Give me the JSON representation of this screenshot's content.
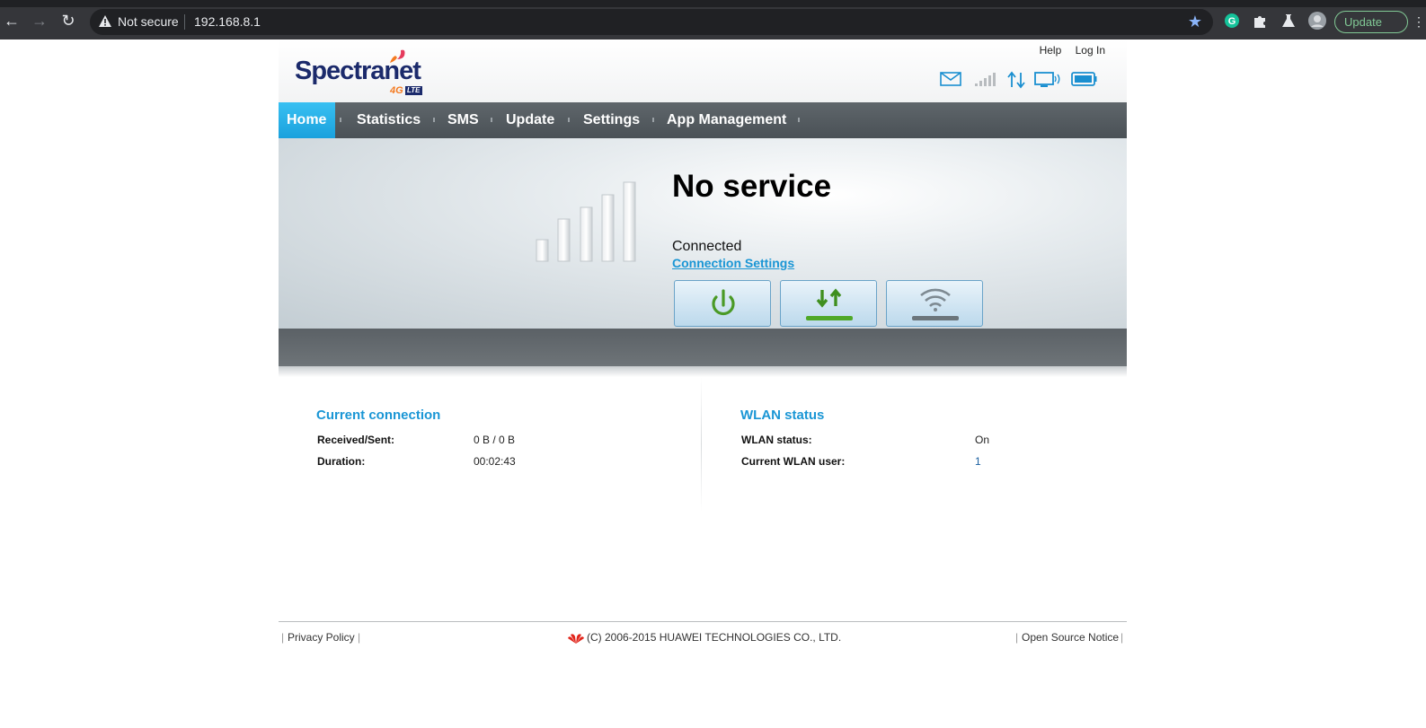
{
  "browser": {
    "security_label": "Not secure",
    "url": "192.168.8.1",
    "update_label": "Update"
  },
  "header": {
    "brand": "Spectranet",
    "brand_sub": "4G",
    "brand_badge": "LTE",
    "links": {
      "help": "Help",
      "login": "Log In"
    }
  },
  "menu": {
    "items": [
      {
        "label": "Home",
        "active": true
      },
      {
        "label": "Statistics"
      },
      {
        "label": "SMS"
      },
      {
        "label": "Update"
      },
      {
        "label": "Settings"
      },
      {
        "label": "App Management"
      }
    ]
  },
  "hero": {
    "title": "No service",
    "status": "Connected",
    "settings_link": "Connection Settings",
    "buttons": [
      "power-icon",
      "data-transfer-icon",
      "wifi-icon"
    ]
  },
  "current_connection": {
    "title": "Current connection",
    "received_sent_label": "Received/Sent:",
    "received_sent_value": "0 B /  0 B",
    "duration_label": "Duration:",
    "duration_value": "00:02:43"
  },
  "wlan": {
    "title": "WLAN status",
    "status_label": "WLAN status:",
    "status_value": "On",
    "users_label": "Current WLAN user:",
    "users_value": "1"
  },
  "footer": {
    "privacy": "Privacy Policy",
    "copyright": "(C) 2006-2015 HUAWEI TECHNOLOGIES CO., LTD.",
    "open_source": "Open Source Notice"
  },
  "colors": {
    "accent": "#1a96d5",
    "menu_active": "#29b2ea",
    "menu_bg": "#545b60",
    "brand_navy": "#1b2a6b",
    "brand_orange": "#f47a20"
  }
}
